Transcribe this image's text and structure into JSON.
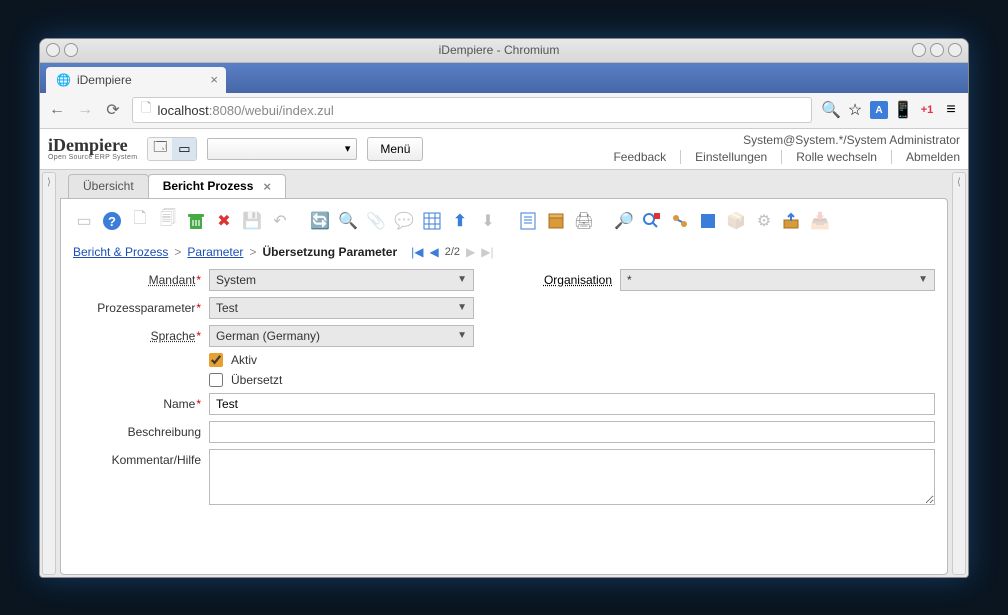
{
  "window": {
    "title": "iDempiere - Chromium"
  },
  "browser": {
    "tab_title": "iDempiere",
    "url_host": "localhost",
    "url_port_path": ":8080/webui/index.zul"
  },
  "header": {
    "logo": "iDempiere",
    "logo_sub": "Open Source ERP System",
    "menu_button": "Menü",
    "user_info": "System@System.*/System Administrator",
    "links": {
      "feedback": "Feedback",
      "settings": "Einstellungen",
      "switchrole": "Rolle wechseln",
      "logout": "Abmelden"
    }
  },
  "tabs": {
    "overview": "Übersicht",
    "active": "Bericht Prozess"
  },
  "breadcrumb": {
    "l1": "Bericht & Prozess",
    "l2": "Parameter",
    "current": "Übersetzung Parameter",
    "record": "2/2"
  },
  "form": {
    "mandant_label": "Mandant",
    "mandant_value": "System",
    "organisation_label": "Organisation",
    "organisation_value": "*",
    "prozessparam_label": "Prozessparameter",
    "prozessparam_value": "Test",
    "sprache_label": "Sprache",
    "sprache_value": "German (Germany)",
    "aktiv_label": "Aktiv",
    "aktiv_checked": true,
    "uebersetzt_label": "Übersetzt",
    "uebersetzt_checked": false,
    "name_label": "Name",
    "name_value": "Test",
    "beschreibung_label": "Beschreibung",
    "beschreibung_value": "",
    "kommentar_label": "Kommentar/Hilfe",
    "kommentar_value": ""
  }
}
